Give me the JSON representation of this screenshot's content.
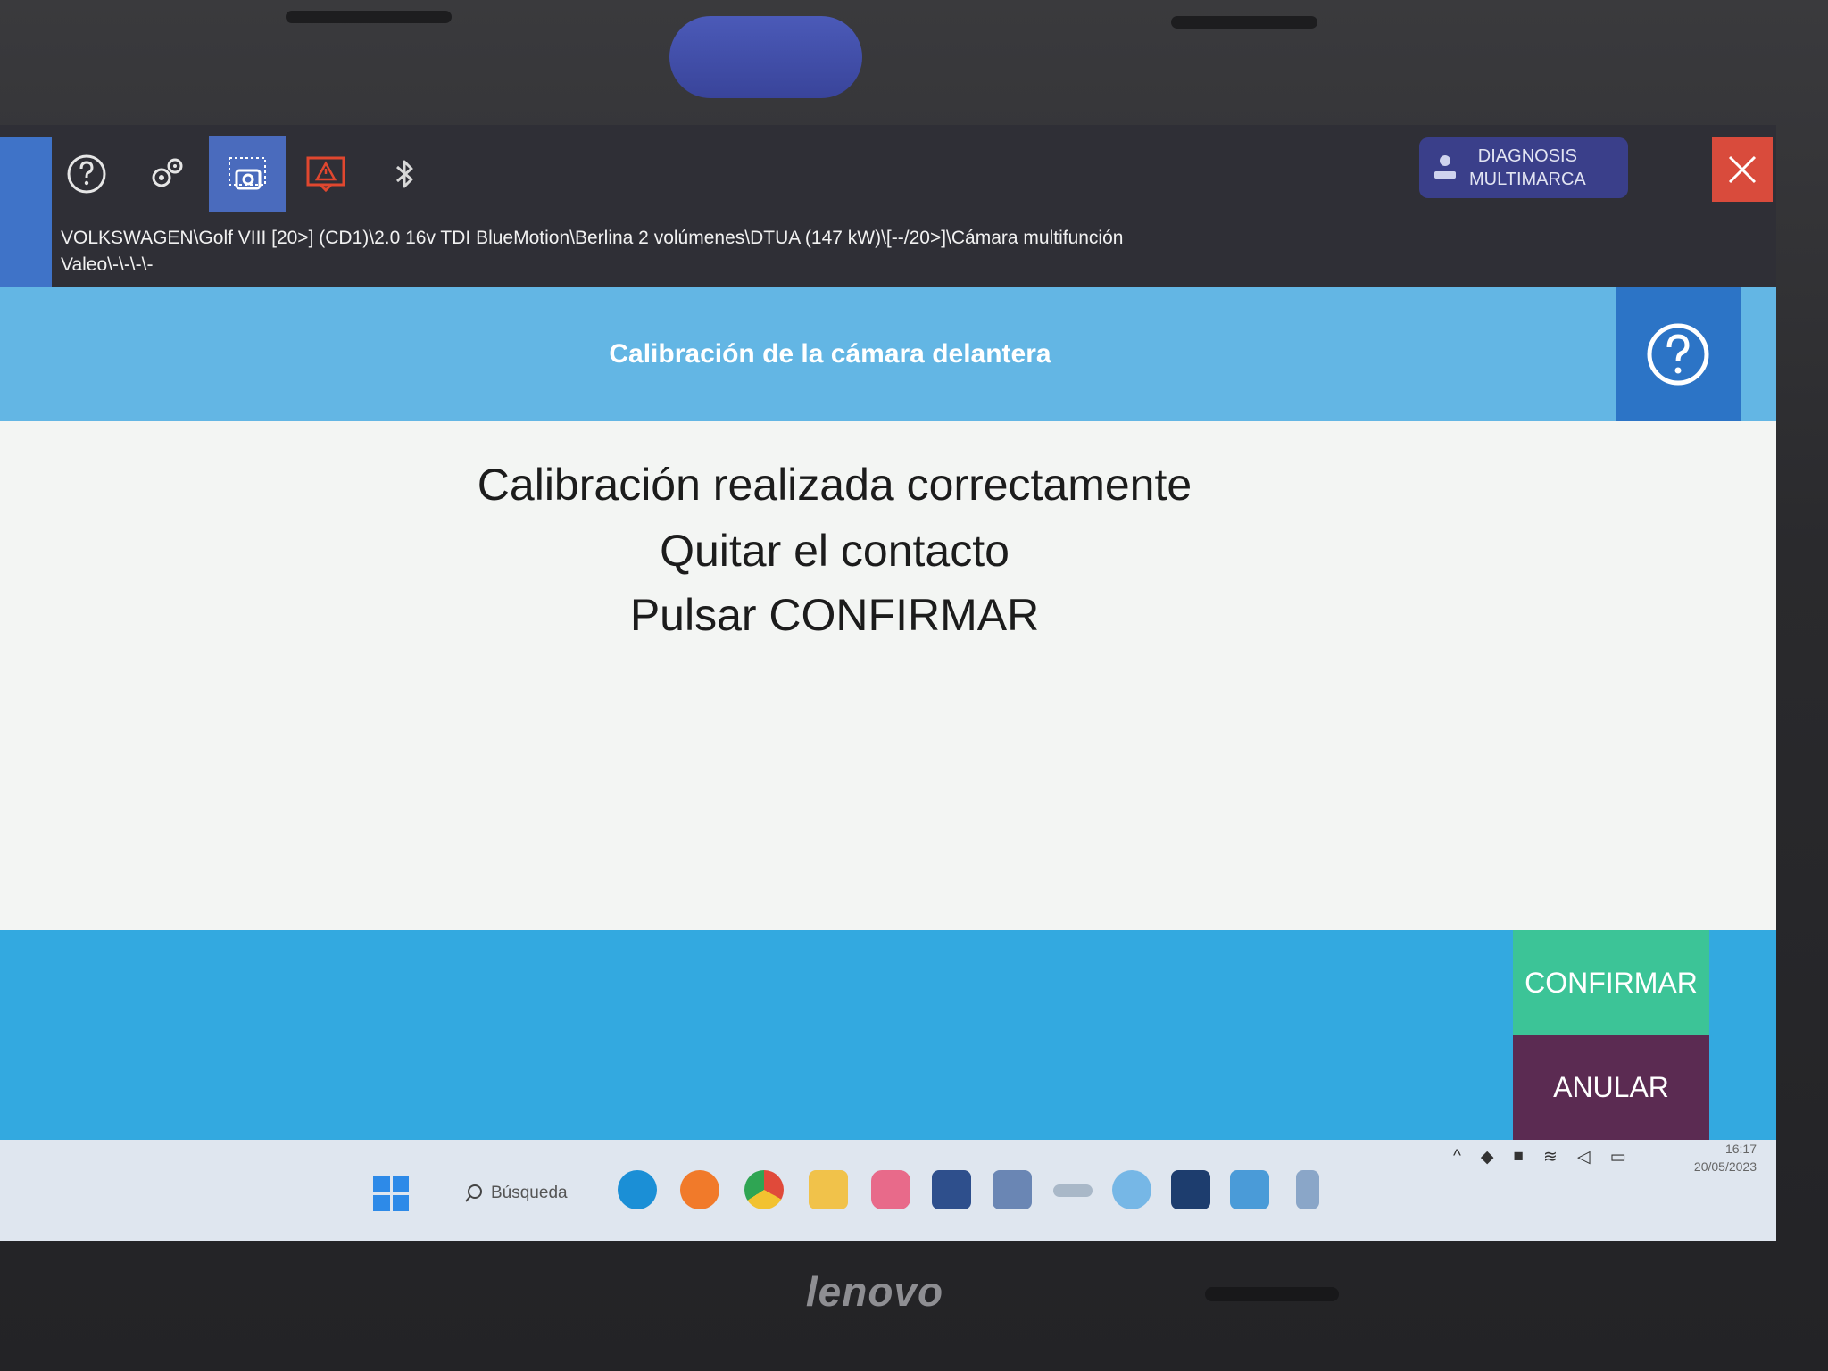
{
  "device": {
    "brand": "lenovo"
  },
  "toolbar": {
    "icons": [
      "help-icon",
      "settings-icon",
      "screenshot-icon",
      "warning-icon",
      "bluetooth-icon"
    ],
    "brand_button": {
      "line1": "DIAGNOSIS",
      "line2": "MULTIMARCA"
    },
    "breadcrumb_line1": "VOLKSWAGEN\\Golf VIII [20>] (CD1)\\2.0 16v TDI BlueMotion\\Berlina 2 volúmenes\\DTUA (147 kW)\\[--/20>]\\Cámara multifunción",
    "breadcrumb_line2": "Valeo\\-\\-\\-\\-"
  },
  "title": "Calibración de la cámara delantera",
  "message": {
    "line1": "Calibración realizada correctamente",
    "line2": "Quitar el contacto",
    "line3": "Pulsar CONFIRMAR"
  },
  "actions": {
    "confirm_label": "CONFIRMAR",
    "cancel_label": "ANULAR"
  },
  "taskbar": {
    "search_label": "Búsqueda",
    "time": "16:17",
    "date": "20/05/2023"
  },
  "colors": {
    "toolbar_bg": "#2f2f36",
    "title_band": "#63b6e4",
    "action_band": "#33a9e0",
    "confirm": "#3cc497",
    "cancel": "#5b2b52",
    "close": "#d94b3c"
  }
}
